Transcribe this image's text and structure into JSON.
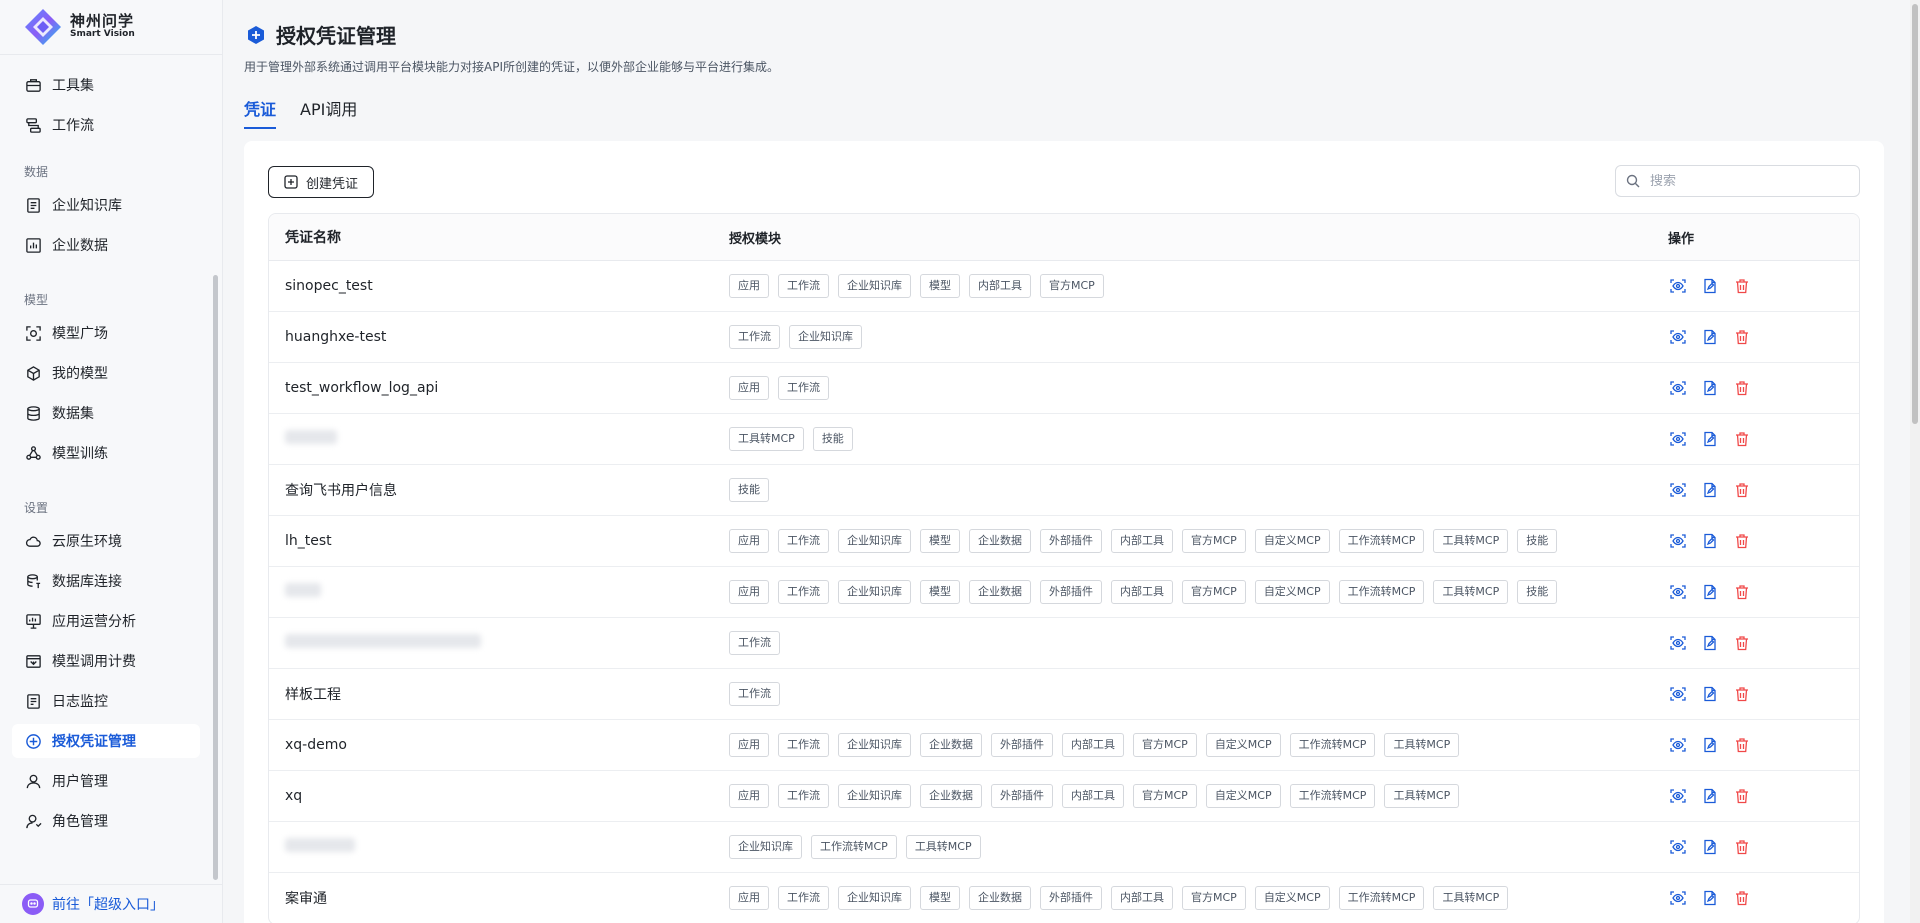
{
  "brand": {
    "name_cn": "神州问学",
    "name_en": "Smart Vision"
  },
  "sidebar": {
    "items_top": [
      {
        "label": "工具集",
        "icon": "toolbox-icon"
      },
      {
        "label": "工作流",
        "icon": "workflow-icon"
      }
    ],
    "group_data": "数据",
    "items_data": [
      {
        "label": "企业知识库",
        "icon": "book-icon"
      },
      {
        "label": "企业数据",
        "icon": "chart-icon"
      }
    ],
    "group_model": "模型",
    "items_model": [
      {
        "label": "模型广场",
        "icon": "model-plaza-icon"
      },
      {
        "label": "我的模型",
        "icon": "cube-icon"
      },
      {
        "label": "数据集",
        "icon": "database-icon"
      },
      {
        "label": "模型训练",
        "icon": "training-icon"
      }
    ],
    "group_settings": "设置",
    "items_settings": [
      {
        "label": "云原生环境",
        "icon": "cloud-icon"
      },
      {
        "label": "数据库连接",
        "icon": "db-link-icon"
      },
      {
        "label": "应用运营分析",
        "icon": "monitor-icon"
      },
      {
        "label": "模型调用计费",
        "icon": "billing-icon"
      },
      {
        "label": "日志监控",
        "icon": "log-icon"
      },
      {
        "label": "授权凭证管理",
        "icon": "plus-circle-icon",
        "active": true
      },
      {
        "label": "用户管理",
        "icon": "user-icon"
      },
      {
        "label": "角色管理",
        "icon": "role-icon"
      }
    ],
    "footer": "前往「超级入口」"
  },
  "page": {
    "title": "授权凭证管理",
    "description": "用于管理外部系统通过调用平台模块能力对接API所创建的凭证，以便外部企业能够与平台进行集成。",
    "tabs": [
      "凭证",
      "API调用"
    ],
    "active_tab": "凭证",
    "create_button": "创建凭证",
    "search_placeholder": "搜索"
  },
  "table": {
    "headers": {
      "name": "凭证名称",
      "modules": "授权模块",
      "actions": "操作"
    },
    "rows": [
      {
        "name": "sinopec_test",
        "modules": [
          "应用",
          "工作流",
          "企业知识库",
          "模型",
          "内部工具",
          "官方MCP"
        ]
      },
      {
        "name": "huanghxe-test",
        "modules": [
          "工作流",
          "企业知识库"
        ]
      },
      {
        "name": "test_workflow_log_api",
        "modules": [
          "应用",
          "工作流"
        ]
      },
      {
        "name": "",
        "redacted": true,
        "redact_w": 52,
        "modules": [
          "工具转MCP",
          "技能"
        ]
      },
      {
        "name": "查询飞书用户信息",
        "modules": [
          "技能"
        ]
      },
      {
        "name": "lh_test",
        "modules": [
          "应用",
          "工作流",
          "企业知识库",
          "模型",
          "企业数据",
          "外部插件",
          "内部工具",
          "官方MCP",
          "自定义MCP",
          "工作流转MCP",
          "工具转MCP",
          "技能"
        ]
      },
      {
        "name": "",
        "redacted": true,
        "redact_w": 36,
        "modules": [
          "应用",
          "工作流",
          "企业知识库",
          "模型",
          "企业数据",
          "外部插件",
          "内部工具",
          "官方MCP",
          "自定义MCP",
          "工作流转MCP",
          "工具转MCP",
          "技能"
        ]
      },
      {
        "name": "",
        "redacted": true,
        "redact_w": 196,
        "modules": [
          "工作流"
        ]
      },
      {
        "name": "样板工程",
        "modules": [
          "工作流"
        ]
      },
      {
        "name": "xq-demo",
        "modules": [
          "应用",
          "工作流",
          "企业知识库",
          "企业数据",
          "外部插件",
          "内部工具",
          "官方MCP",
          "自定义MCP",
          "工作流转MCP",
          "工具转MCP"
        ]
      },
      {
        "name": "xq",
        "modules": [
          "应用",
          "工作流",
          "企业知识库",
          "企业数据",
          "外部插件",
          "内部工具",
          "官方MCP",
          "自定义MCP",
          "工作流转MCP",
          "工具转MCP"
        ]
      },
      {
        "name": "",
        "redacted": true,
        "redact_w": 70,
        "modules": [
          "企业知识库",
          "工作流转MCP",
          "工具转MCP"
        ]
      },
      {
        "name": "案审通",
        "modules": [
          "应用",
          "工作流",
          "企业知识库",
          "模型",
          "企业数据",
          "外部插件",
          "内部工具",
          "官方MCP",
          "自定义MCP",
          "工作流转MCP",
          "工具转MCP"
        ]
      }
    ],
    "actions": [
      {
        "name": "view-icon",
        "color": "#1a5bd8"
      },
      {
        "name": "edit-doc-icon",
        "color": "#1a5bd8"
      },
      {
        "name": "delete-icon",
        "color": "#f04848"
      }
    ]
  },
  "colors": {
    "accent": "#1a5bd8",
    "danger": "#f04848"
  }
}
